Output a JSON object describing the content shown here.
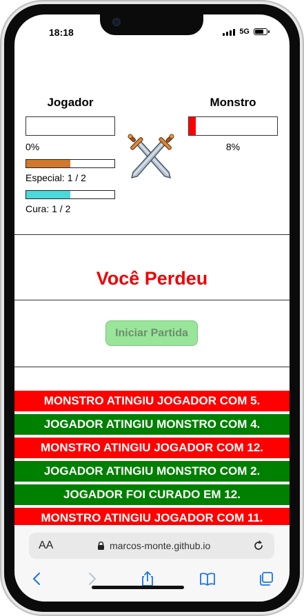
{
  "status_bar": {
    "time": "18:18",
    "network": "5G"
  },
  "player": {
    "title": "Jogador",
    "life_percent_text": "0%",
    "life_fraction": 0,
    "special_label": "Especial: 1 / 2",
    "special_fraction": 0.5,
    "heal_label": "Cura: 1 / 2",
    "heal_fraction": 0.5
  },
  "monster": {
    "title": "Monstro",
    "life_percent_text": "8%",
    "life_fraction": 0.08
  },
  "result": {
    "text": "Você Perdeu"
  },
  "start_button": {
    "label": "Iniciar Partida"
  },
  "logs": [
    {
      "text": "MONSTRO ATINGIU JOGADOR COM 5.",
      "color": "#ff0000"
    },
    {
      "text": "JOGADOR ATINGIU MONSTRO COM 4.",
      "color": "#008000"
    },
    {
      "text": "MONSTRO ATINGIU JOGADOR COM 12.",
      "color": "#ff0000"
    },
    {
      "text": "JOGADOR ATINGIU MONSTRO COM 2.",
      "color": "#008000"
    },
    {
      "text": "JOGADOR FOI CURADO EM 12.",
      "color": "#008000"
    },
    {
      "text": "MONSTRO ATINGIU JOGADOR COM 11.",
      "color": "#ff0000"
    }
  ],
  "browser": {
    "url": "marcos-monte.github.io",
    "text_size_label": "AA"
  },
  "colors": {
    "special_bar": "#d2782c",
    "heal_bar": "#4dd9d9",
    "life_bar": "#ff0000",
    "result_text": "#ee0000",
    "safari_accent": "#1a73e8"
  },
  "icons": {
    "swords": "crossed-swords-icon",
    "lock": "lock-icon",
    "reload": "reload-icon",
    "back": "chevron-left-icon",
    "forward": "chevron-right-icon",
    "share": "share-icon",
    "bookmarks": "book-icon",
    "tabs": "tabs-icon"
  }
}
